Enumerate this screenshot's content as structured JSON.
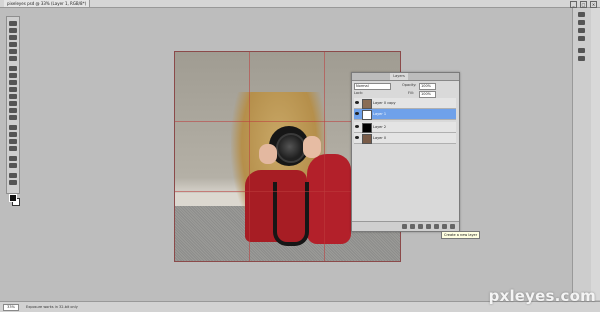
{
  "document_tab": {
    "label": "pixeleyes psd @ 33% (Layer 1, RGB/8*)"
  },
  "window_controls": [
    "_",
    "□",
    "×"
  ],
  "layers_panel": {
    "tabs": [
      "",
      "",
      "Layers",
      "",
      ""
    ],
    "blend_mode": "Normal",
    "opacity_label": "Opacity:",
    "opacity_value": "100%",
    "lock_label": "Lock:",
    "fill_label": "Fill:",
    "fill_value": "100%",
    "layers": [
      {
        "name": "Layer 0 copy",
        "visible": true,
        "selected": false,
        "thumb": "photo"
      },
      {
        "name": "Layer 1",
        "visible": true,
        "selected": true,
        "thumb": "white"
      },
      {
        "name": "Layer 2",
        "visible": true,
        "selected": false,
        "thumb": "black"
      },
      {
        "name": "Layer 0",
        "visible": true,
        "selected": false,
        "thumb": "photo"
      }
    ]
  },
  "tooltip": {
    "text": "Create a new layer"
  },
  "statusbar": {
    "zoom": "33%",
    "doc_info": "Exposure works in 32-bit only"
  },
  "watermark": {
    "text": "pxleyes.com"
  },
  "colors": {
    "selection": "#6fa1ea",
    "guide": "#be3c3c",
    "sweater": "#b3202a"
  }
}
